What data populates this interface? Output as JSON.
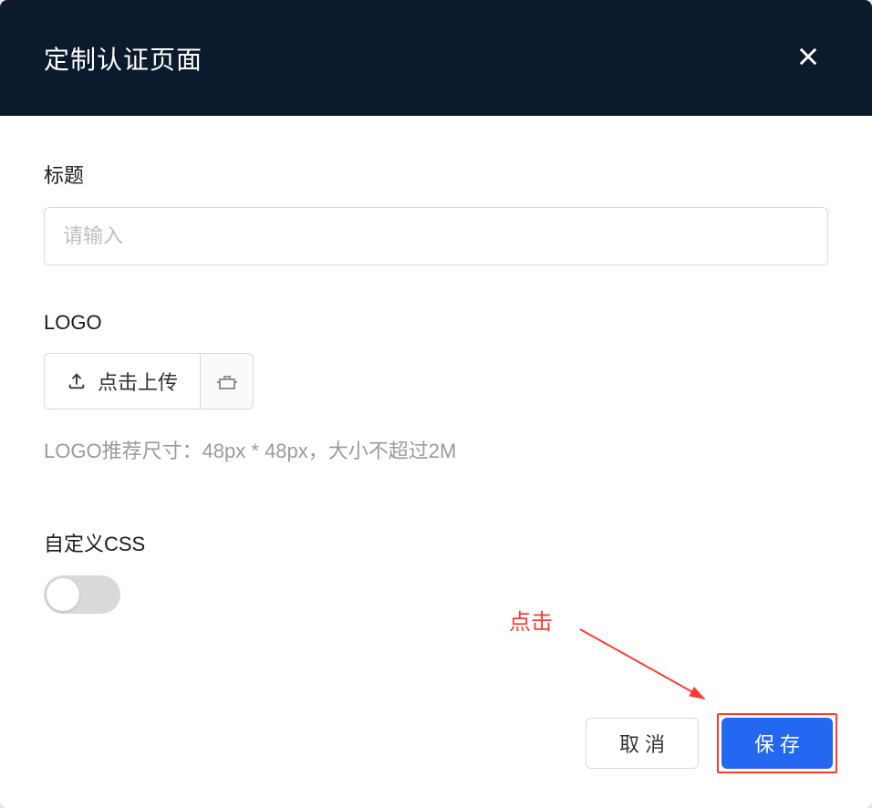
{
  "header": {
    "title": "定制认证页面"
  },
  "form": {
    "title": {
      "label": "标题",
      "placeholder": "请输入"
    },
    "logo": {
      "label": "LOGO",
      "upload_label": "点击上传",
      "hint": "LOGO推荐尺寸：48px * 48px，大小不超过2M"
    },
    "custom_css": {
      "label": "自定义CSS",
      "enabled": false
    }
  },
  "footer": {
    "cancel_label": "取消",
    "save_label": "保存"
  },
  "annotation": {
    "label": "点击"
  }
}
